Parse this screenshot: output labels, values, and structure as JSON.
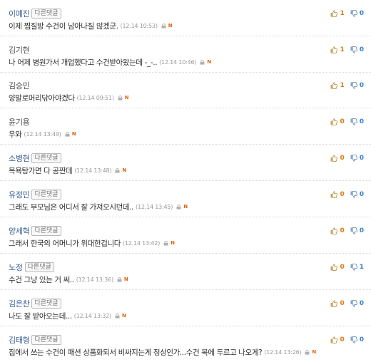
{
  "colors": {
    "author": "#3a5f99",
    "like_count": "#e07a10",
    "dislike_count": "#2f7fd1",
    "new_badge": "#e0640f"
  },
  "comments": [
    {
      "author": "이예진",
      "badge": "다른댓글",
      "text": "이제 찜질방 수건이 남아나질 않겠군.",
      "time": "(12.14 10:53)",
      "likes": "1",
      "dislikes": "0"
    },
    {
      "author": "김기현",
      "badge": "",
      "text": "나 어제 병원가서 개업했다고 수건받아왔는데 -_-..",
      "time": "(12.14 10:46)",
      "likes": "1",
      "dislikes": "0"
    },
    {
      "author": "김승민",
      "badge": "",
      "text": "양말로머리닦아야겠다",
      "time": "(12.14 09:51)",
      "likes": "1",
      "dislikes": "0"
    },
    {
      "author": "윤기용",
      "badge": "",
      "text": "우와",
      "time": "(12.14 13:49)",
      "likes": "0",
      "dislikes": "0"
    },
    {
      "author": "소병현",
      "badge": "다른댓글",
      "text": "목욕탕가면 다 공짠데",
      "time": "(12.14 13:48)",
      "likes": "0",
      "dislikes": "0"
    },
    {
      "author": "유정민",
      "badge": "다른댓글",
      "text": "그래도 부모님은 어디서 잘 가져오시던데..",
      "time": "(12.14 13:45)",
      "likes": "0",
      "dislikes": "0"
    },
    {
      "author": "양세혁",
      "badge": "다른댓글",
      "text": "그래서 한국의 어머니가 위대한겁니다",
      "time": "(12.14 13:42)",
      "likes": "0",
      "dislikes": "0"
    },
    {
      "author": "노정",
      "badge": "다른댓글",
      "text": "수건 그냥 있는 거 써..",
      "time": "(12.14 13:36)",
      "likes": "0",
      "dislikes": "1"
    },
    {
      "author": "김은찬",
      "badge": "다른댓글",
      "text": "나도 잘 받아오는데...",
      "time": "(12.14 13:32)",
      "likes": "0",
      "dislikes": "0"
    },
    {
      "author": "김태형",
      "badge": "다른댓글",
      "text": "집에서 쓰는 수건이 패션 상품화되서 비싸지는게 정상인가...수건 목에 두르고 나오게?",
      "time": "(12.14 13:26)",
      "likes": "0",
      "dislikes": "0"
    }
  ]
}
